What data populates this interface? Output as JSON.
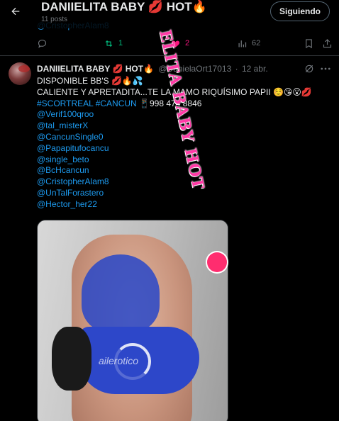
{
  "header": {
    "title": "DANIIELITA BABY 💋 HOT🔥",
    "subtitle": "11 posts",
    "follow_label": "Siguiendo"
  },
  "prev_tweet": {
    "mention_cutoff": "@CristopherAlam8",
    "retweets": "1",
    "likes": "2",
    "views": "62",
    "retweet_color": "#00ba7c",
    "like_color": "#f91880"
  },
  "tweet": {
    "name": "DANIIELITA BABY 💋 HOT🔥",
    "handle": "@DanielaOrt17013",
    "dot": "·",
    "date": "12 abr.",
    "line1": "DISPONIBLE BB'S 💋🔥💦",
    "line2": "CALIENTE Y APRETADITA...TE LA MAMO RIQUÍSIMO PAPII ☺️😘😮💋",
    "hashtag1": "#SCORTREAL",
    "hashtag2": "#CANCUN",
    "phone": "📱998 474 8846",
    "mentions": [
      "@Verif100qroo",
      "@tal_misterX",
      "@CancunSingle0",
      "@Papapitufocancu",
      "@single_beto",
      "@BcHcancun",
      "@CristopherAlam8",
      "@UnTalForastero",
      "@Hector_her22"
    ],
    "media": {
      "overlay_text": "ELITA BABY HOT",
      "watermark": "ailerotico"
    }
  },
  "colors": {
    "background": "#000000",
    "text": "#e7e9ea",
    "muted": "#71767b",
    "link": "#1d9bf0",
    "border": "#2f3336"
  },
  "icons": {
    "back": "arrow-left-icon",
    "reply": "reply-icon",
    "retweet": "retweet-icon",
    "like": "heart-icon",
    "views": "bar-chart-icon",
    "bookmark": "bookmark-icon",
    "share": "share-icon",
    "grok": "grok-icon",
    "more": "more-icon"
  }
}
